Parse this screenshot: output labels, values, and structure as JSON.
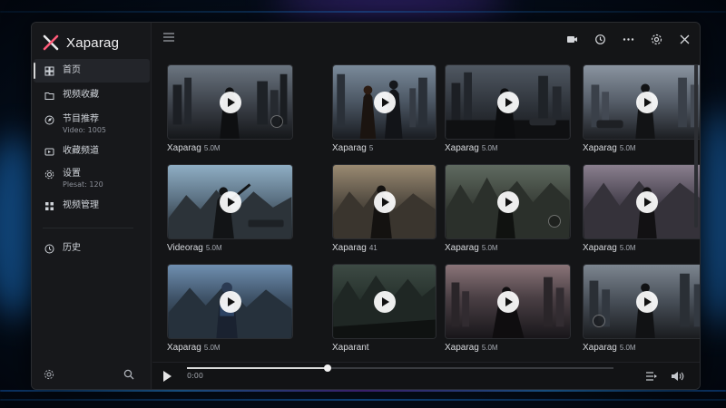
{
  "app": {
    "name": "Xaparag"
  },
  "sidebar": {
    "items": [
      {
        "label": "首页",
        "sub": "",
        "icon": "home-icon",
        "active": true
      },
      {
        "label": "视频收藏",
        "sub": "",
        "icon": "folder-icon"
      },
      {
        "label": "节目推荐",
        "sub": "Video: 1005",
        "icon": "compass-icon"
      },
      {
        "label": "收藏频道",
        "sub": "",
        "icon": "channels-icon"
      },
      {
        "label": "设置",
        "sub": "Plesat: 120",
        "icon": "gear-icon"
      },
      {
        "label": "视频管理",
        "sub": "",
        "icon": "grid-icon"
      },
      {
        "label": "历史",
        "sub": "",
        "icon": "clock-icon"
      }
    ]
  },
  "topbar": {
    "icons": [
      "camera-icon",
      "history-icon",
      "more-icon",
      "settings-icon",
      "close-icon"
    ]
  },
  "videos": [
    {
      "title": "Xaparag",
      "meta": "5.0M"
    },
    {
      "title": "Xaparag",
      "meta": "5"
    },
    {
      "title": "Xaparag",
      "meta": "5.0M"
    },
    {
      "title": "Xaparag",
      "meta": "5.0M"
    },
    {
      "title": "Videorag",
      "meta": "5.0M"
    },
    {
      "title": "Xaparag",
      "meta": "41"
    },
    {
      "title": "Xaparag",
      "meta": "5.0M"
    },
    {
      "title": "Xaparag",
      "meta": "5.0M"
    },
    {
      "title": "Xaparag",
      "meta": "5.0M"
    },
    {
      "title": "Xaparant",
      "meta": ""
    },
    {
      "title": "Xaparag",
      "meta": "5.0M"
    },
    {
      "title": "Xaparag",
      "meta": "5.0M"
    }
  ],
  "player": {
    "time": "0:00",
    "progress_fraction": 0.33
  },
  "colors": {
    "accent": "#d9d9d9",
    "panel": "#141517",
    "sidebar": "#17181b"
  }
}
